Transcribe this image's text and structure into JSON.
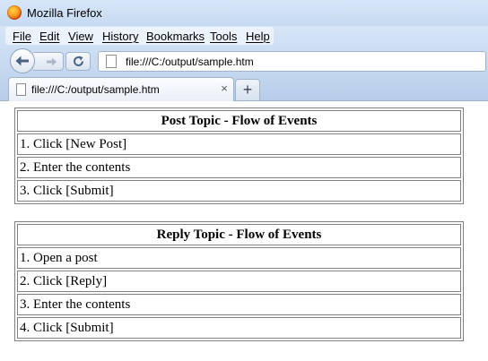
{
  "window": {
    "title": "Mozilla Firefox"
  },
  "menubar": {
    "items": [
      {
        "key": "F",
        "rest": "ile"
      },
      {
        "key": "E",
        "rest": "dit"
      },
      {
        "key": "V",
        "rest": "iew"
      },
      {
        "key": "H",
        "rest": "istory"
      },
      {
        "key": "B",
        "rest": "ookmarks"
      },
      {
        "key": "T",
        "rest": "ools"
      },
      {
        "key": "H",
        "rest": "elp"
      }
    ]
  },
  "navbar": {
    "url": "file:///C:/output/sample.htm"
  },
  "tabs": {
    "active_title": "file:///C:/output/sample.htm",
    "close_glyph": "×",
    "new_tab_glyph": "+"
  },
  "tables": [
    {
      "title": "Post Topic - Flow of Events",
      "rows": [
        "1. Click [New Post]",
        "2. Enter the contents",
        "3. Click [Submit]"
      ]
    },
    {
      "title": "Reply Topic - Flow of Events",
      "rows": [
        "1. Open a post",
        "2. Click [Reply]",
        "3. Enter the contents",
        "4. Click [Submit]"
      ]
    }
  ]
}
